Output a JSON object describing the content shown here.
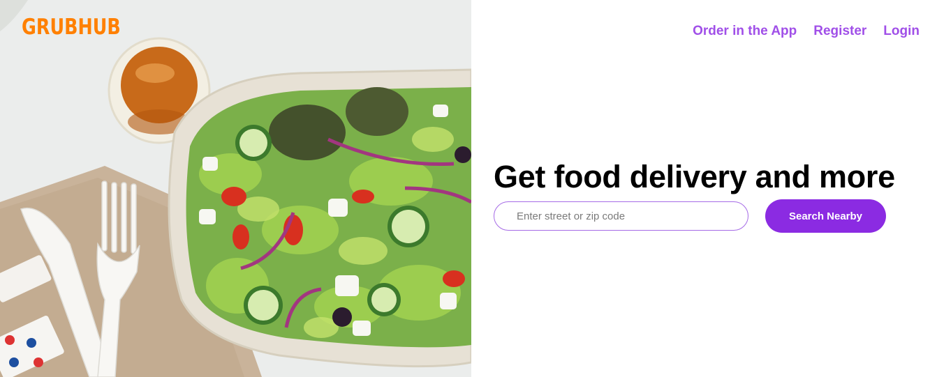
{
  "brand": {
    "logo_text": "GRUBHUB",
    "logo_color": "#ff8000"
  },
  "nav": {
    "items": [
      {
        "label": "Order in the App"
      },
      {
        "label": "Register"
      },
      {
        "label": "Login"
      }
    ],
    "link_color": "#a04fe8"
  },
  "hero": {
    "image_subject": "greek-salad-in-takeout-bowl",
    "headline": "Get food delivery and more"
  },
  "search": {
    "placeholder": "Enter street or zip code",
    "value": "",
    "button_label": "Search Nearby",
    "button_color": "#8b2be2"
  }
}
